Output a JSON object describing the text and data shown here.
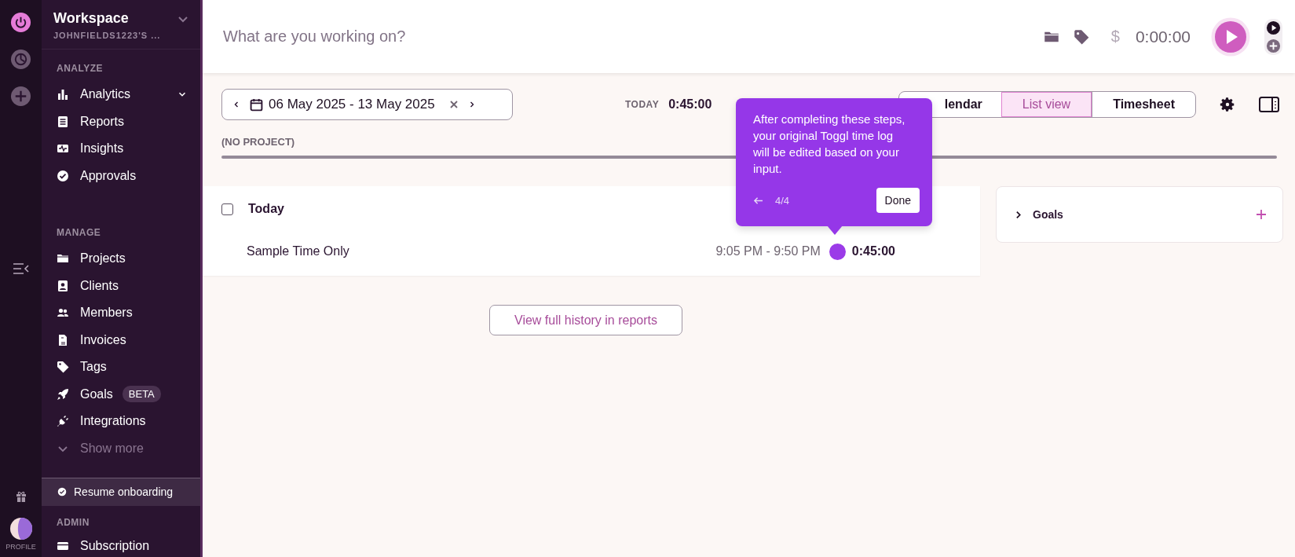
{
  "rail": {
    "profile_label": "PROFILE"
  },
  "workspace": {
    "name": "Workspace",
    "subtitle": "JOHNFIELDS1223'S ..."
  },
  "sidebar": {
    "sections": [
      {
        "title": "ANALYZE",
        "items": [
          {
            "label": "Analytics",
            "kind": "chart",
            "expandable": true
          },
          {
            "label": "Reports",
            "kind": "report",
            "expandable": false
          },
          {
            "label": "Insights",
            "kind": "insights",
            "expandable": false
          },
          {
            "label": "Approvals",
            "kind": "check",
            "expandable": false
          }
        ]
      },
      {
        "title": "MANAGE",
        "items": [
          {
            "label": "Projects",
            "kind": "folder",
            "expandable": false
          },
          {
            "label": "Clients",
            "kind": "client",
            "expandable": false
          },
          {
            "label": "Members",
            "kind": "members",
            "expandable": false
          },
          {
            "label": "Invoices",
            "kind": "invoice",
            "expandable": false
          },
          {
            "label": "Tags",
            "kind": "tag",
            "expandable": false
          },
          {
            "label": "Goals",
            "kind": "rocket",
            "expandable": false,
            "badge": "BETA"
          },
          {
            "label": "Integrations",
            "kind": "plug",
            "expandable": false
          },
          {
            "label": "Show more",
            "kind": "more",
            "expandable": false
          }
        ]
      }
    ],
    "onboarding": "Resume onboarding",
    "admin": {
      "title": "ADMIN",
      "items": [
        {
          "label": "Subscription",
          "kind": "card"
        }
      ]
    }
  },
  "topbar": {
    "placeholder": "What are you working on?",
    "billable_symbol": "$",
    "billable": false,
    "timer": "0:00:00"
  },
  "toolbar": {
    "date_range": "06 May 2025 - 13 May 2025",
    "today_label": "TODAY",
    "today_total": "0:45:00",
    "views": [
      {
        "label": "lendar",
        "selected": false
      },
      {
        "label": "List view",
        "selected": true
      },
      {
        "label": "Timesheet",
        "selected": false
      }
    ]
  },
  "project_label": "(NO PROJECT)",
  "day": {
    "title": "Today",
    "checked": false,
    "entries": [
      {
        "description": "Sample Time Only",
        "time_range": "9:05 PM - 9:50 PM",
        "color": "#9b3be8",
        "duration": "0:45:00"
      }
    ]
  },
  "history_button": "View full history in reports",
  "goals": {
    "title": "Goals",
    "expanded": false
  },
  "tooltip": {
    "text": "After completing these steps, your original Toggl time log will be edited based on your input.",
    "step": "4/4",
    "button": "Done"
  }
}
